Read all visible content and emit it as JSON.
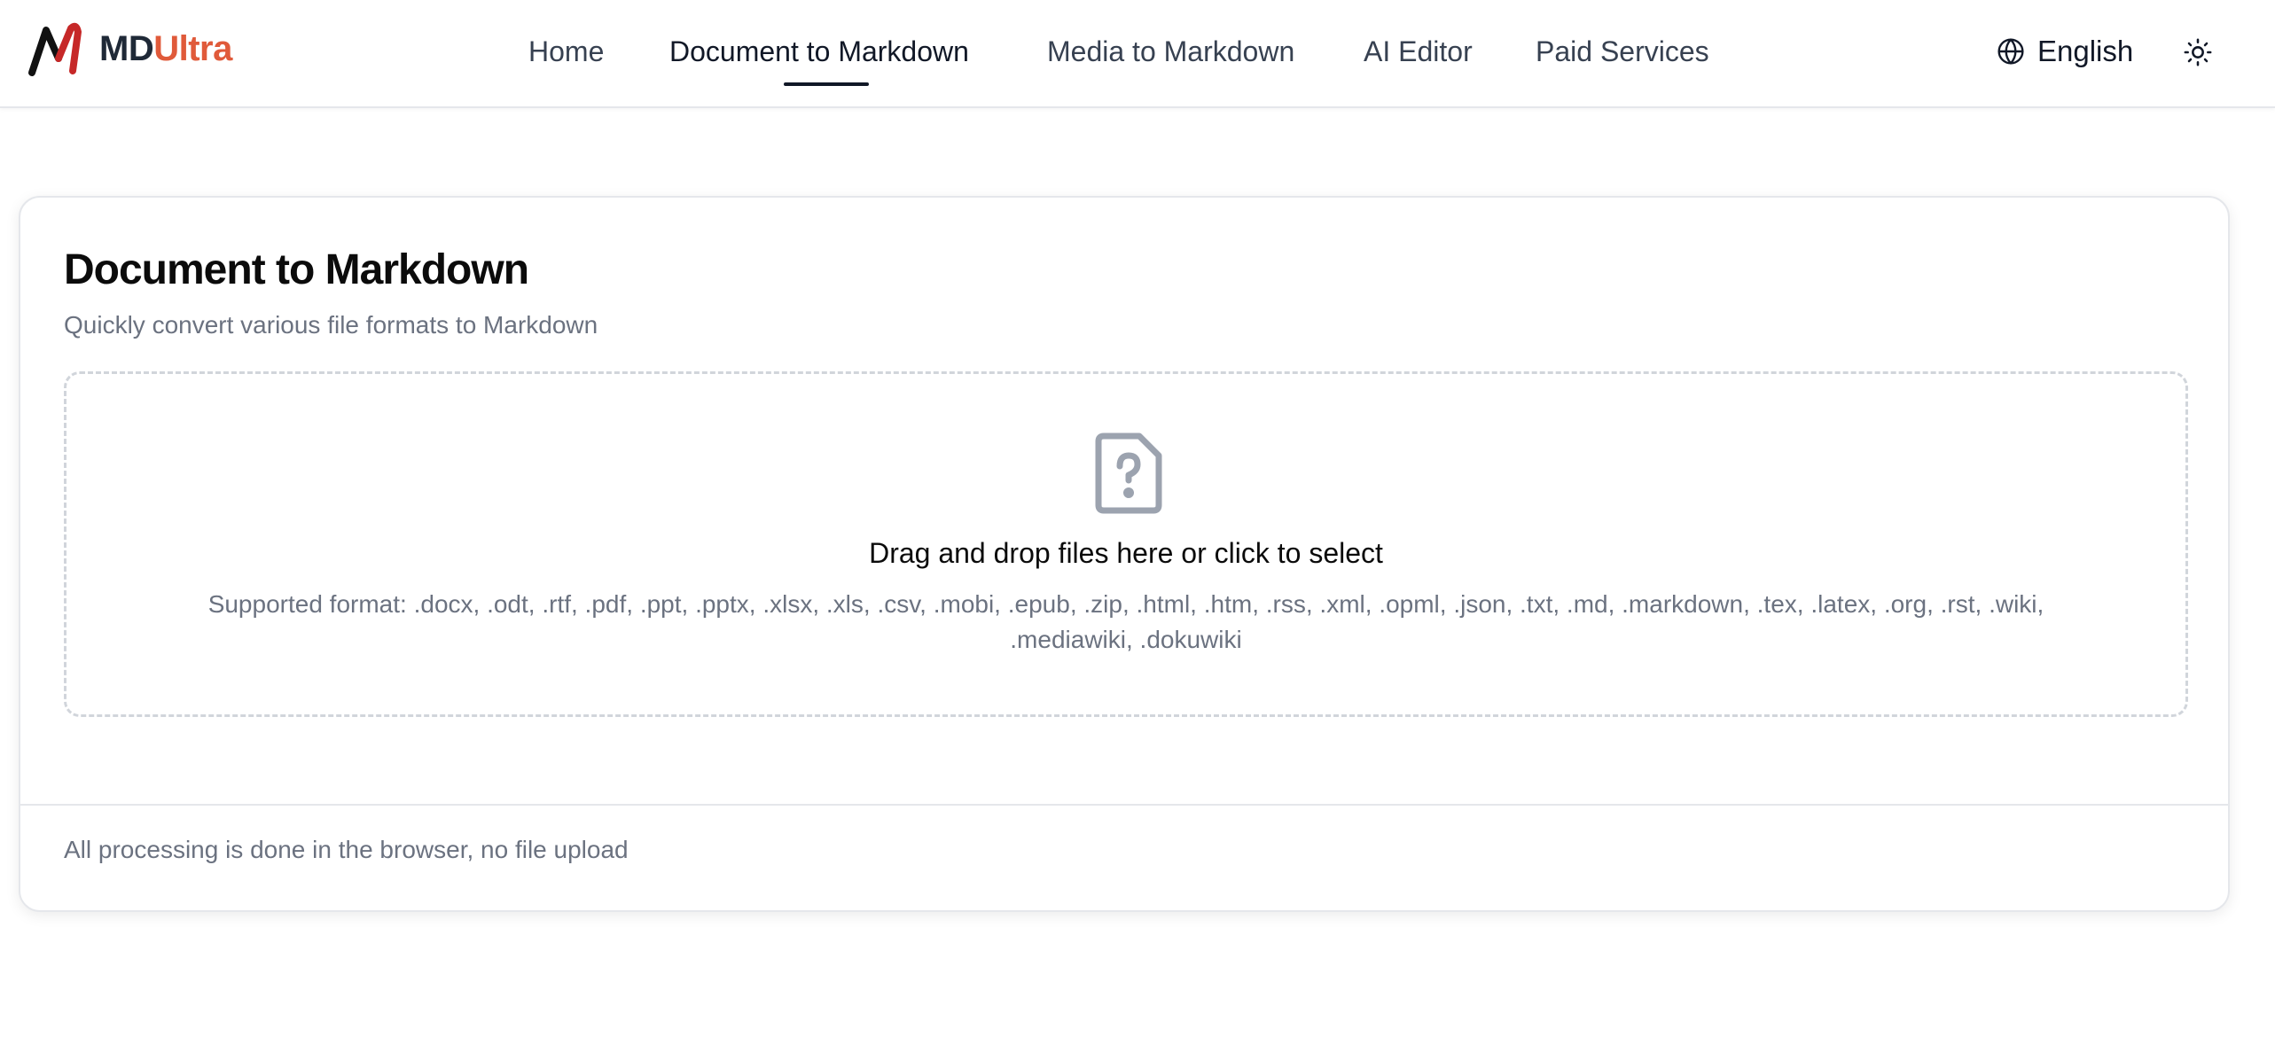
{
  "header": {
    "logo": {
      "icon": "mdultra-logo-icon",
      "text_md": "MD",
      "text_ultra": "Ultra",
      "colors": {
        "md": "#1f2937",
        "ultra": "#e05a3a",
        "mark_dark": "#111111",
        "mark_red": "#c62828"
      }
    },
    "nav": [
      {
        "label": "Home",
        "active": false
      },
      {
        "label": "Document to Markdown",
        "active": true
      },
      {
        "label": "Media to Markdown",
        "active": false
      },
      {
        "label": "AI Editor",
        "active": false
      },
      {
        "label": "Paid Services",
        "active": false
      }
    ],
    "language": {
      "icon": "globe-icon",
      "label": "English"
    },
    "theme_toggle": {
      "icon": "sun-icon"
    }
  },
  "card": {
    "title": "Document to Markdown",
    "subtitle": "Quickly convert various file formats to Markdown",
    "dropzone": {
      "icon": "file-question-icon",
      "title": "Drag and drop files here or click to select",
      "formats": "Supported format: .docx, .odt, .rtf, .pdf, .ppt, .pptx, .xlsx, .xls, .csv, .mobi, .epub, .zip, .html, .htm, .rss, .xml, .opml, .json, .txt, .md, .markdown, .tex, .latex, .org, .rst, .wiki, .mediawiki, .dokuwiki"
    },
    "footer": "All processing is done in the browser, no file upload"
  }
}
